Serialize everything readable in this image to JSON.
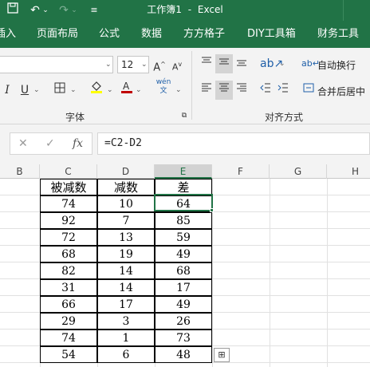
{
  "app": {
    "window_title": "工作簿1",
    "separator": "-",
    "app_name": "Excel"
  },
  "quick_access": [
    "save-icon",
    "undo-icon",
    "redo-icon",
    "customize-icon"
  ],
  "ribbon_tabs": [
    "插入",
    "页面布局",
    "公式",
    "数据",
    "方方格子",
    "DIY工具箱",
    "财务工具"
  ],
  "font": {
    "name_value": "",
    "size_value": "12",
    "group_label": "字体",
    "font_color": "#c00000",
    "highlight_color": "#ffff00"
  },
  "alignment": {
    "wrap_text_label": "自动换行",
    "merge_center_label": "合并后居中",
    "group_label": "对齐方式"
  },
  "formula_bar": {
    "formula": "=C2-D2"
  },
  "columns": [
    "B",
    "C",
    "D",
    "E",
    "F",
    "G",
    "H"
  ],
  "active_column": "E",
  "table": {
    "headers": [
      "被减数",
      "减数",
      "差"
    ],
    "rows": [
      [
        "74",
        "10",
        "64"
      ],
      [
        "92",
        "7",
        "85"
      ],
      [
        "72",
        "13",
        "59"
      ],
      [
        "68",
        "19",
        "49"
      ],
      [
        "82",
        "14",
        "68"
      ],
      [
        "31",
        "14",
        "17"
      ],
      [
        "66",
        "17",
        "49"
      ],
      [
        "29",
        "3",
        "26"
      ],
      [
        "74",
        "1",
        "73"
      ],
      [
        "54",
        "6",
        "48"
      ]
    ]
  }
}
